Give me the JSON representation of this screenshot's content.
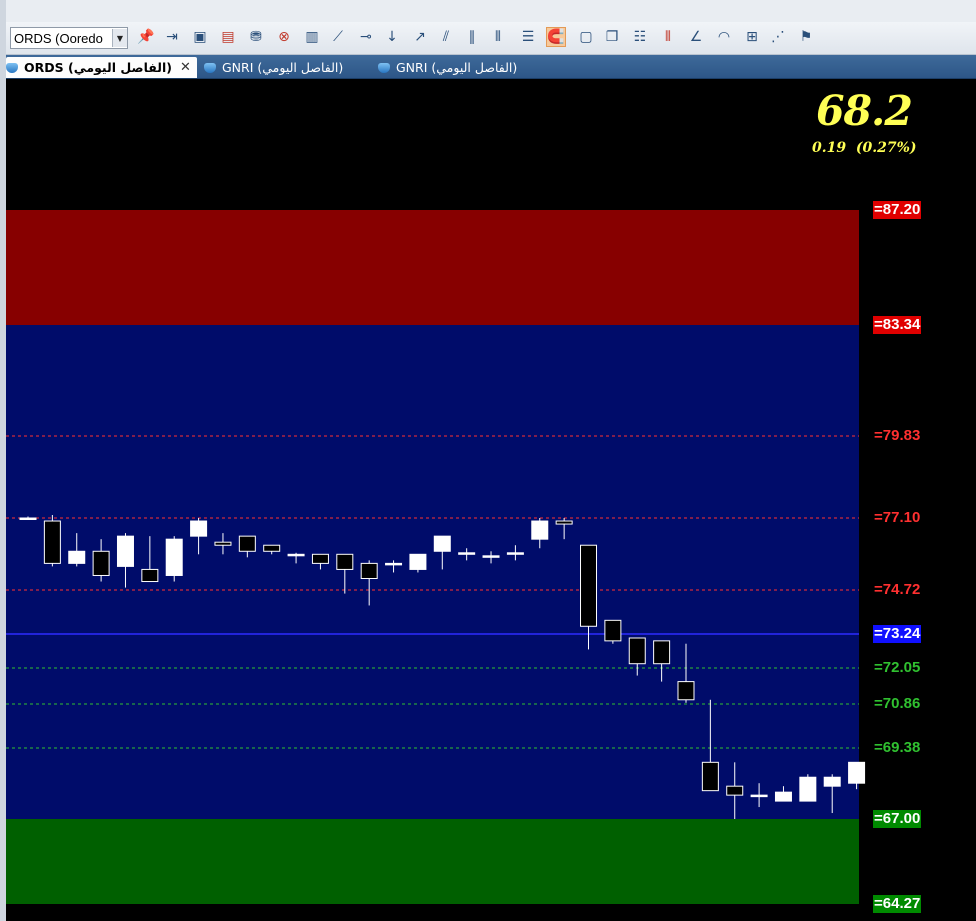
{
  "toolbar": {
    "symbol_select": {
      "value": "ORDS (Ooredo"
    },
    "icons": [
      {
        "name": "pin-icon",
        "glyph": "📌"
      },
      {
        "name": "import-icon",
        "glyph": "⇥"
      },
      {
        "name": "new-chart-icon",
        "glyph": "▣"
      },
      {
        "name": "delete-chart-icon",
        "glyph": "▤"
      },
      {
        "name": "network-icon",
        "glyph": "⛃"
      },
      {
        "name": "close-circle-icon",
        "glyph": "⊗"
      },
      {
        "name": "bar-chart-icon",
        "glyph": "▥"
      },
      {
        "name": "trend-line-icon",
        "glyph": "⟋"
      },
      {
        "name": "horizontal-line-icon",
        "glyph": "⊸"
      },
      {
        "name": "vertical-line-icon",
        "glyph": "↓"
      },
      {
        "name": "ray-icon",
        "glyph": "↗"
      },
      {
        "name": "parallel-lines-icon",
        "glyph": "⫽"
      },
      {
        "name": "double-slash-icon",
        "glyph": "∥"
      },
      {
        "name": "vertical-bars-icon",
        "glyph": "⦀"
      },
      {
        "name": "horizontal-levels-icon",
        "glyph": "☰"
      },
      {
        "name": "magnet-icon",
        "glyph": "🧲"
      },
      {
        "name": "square-icon",
        "glyph": "▢"
      },
      {
        "name": "copy-icon",
        "glyph": "❐"
      },
      {
        "name": "levels-icon",
        "glyph": "☷"
      },
      {
        "name": "vertical-lines-icon",
        "glyph": "⦀"
      },
      {
        "name": "angle-icon",
        "glyph": "∠"
      },
      {
        "name": "arc-icon",
        "glyph": "◠"
      },
      {
        "name": "grid-icon",
        "glyph": "⊞"
      },
      {
        "name": "fan-icon",
        "glyph": "⋰"
      },
      {
        "name": "flag-icon",
        "glyph": "⚑"
      }
    ]
  },
  "tabs": [
    {
      "label": "ORDS (الفاصل اليومي)",
      "active": true,
      "close": "✕"
    },
    {
      "label": "GNRI (الفاصل اليومي)",
      "active": false
    },
    {
      "label": "GNRI (الفاصل اليومي)",
      "active": false
    }
  ],
  "quote": {
    "price": "68.2",
    "change": "0.19  (0.27%)"
  },
  "colors": {
    "red_zone": "#870000",
    "blue_zone": "#000c6a",
    "green_zone": "#006000",
    "red_label_bg": "#e00000",
    "blue_label_bg": "#1010ff",
    "green_label_bg": "#008a00",
    "red_line": "#ff3030",
    "green_line": "#30c030",
    "blue_line": "#2d2dff",
    "price_text": "#ffff55"
  },
  "chart_data": {
    "type": "candlestick",
    "levels": [
      {
        "value": 87.2,
        "label": "=87.20",
        "style": "badge",
        "color": "red"
      },
      {
        "value": 83.34,
        "label": "=83.34",
        "style": "badge",
        "color": "red"
      },
      {
        "value": 79.83,
        "label": "=79.83",
        "style": "dashed",
        "color": "red"
      },
      {
        "value": 77.1,
        "label": "=77.10",
        "style": "dashed",
        "color": "red"
      },
      {
        "value": 74.72,
        "label": "=74.72",
        "style": "dashed",
        "color": "red"
      },
      {
        "value": 73.24,
        "label": "=73.24",
        "style": "badge",
        "color": "blue"
      },
      {
        "value": 72.05,
        "label": "=72.05",
        "style": "dashed",
        "color": "green"
      },
      {
        "value": 70.86,
        "label": "=70.86",
        "style": "dashed",
        "color": "green"
      },
      {
        "value": 69.38,
        "label": "=69.38",
        "style": "dashed",
        "color": "green"
      },
      {
        "value": 67.0,
        "label": "=67.00",
        "style": "badge",
        "color": "green"
      },
      {
        "value": 64.27,
        "label": "=64.27",
        "style": "badge",
        "color": "green"
      }
    ],
    "zones": [
      {
        "from": 87.2,
        "to": 83.34,
        "color": "red"
      },
      {
        "from": 83.34,
        "to": 67.0,
        "color": "blue"
      },
      {
        "from": 67.0,
        "to": 64.27,
        "color": "green"
      }
    ],
    "candles": [
      {
        "o": 77.1,
        "h": 77.15,
        "l": 77.05,
        "c": 77.1
      },
      {
        "o": 77.0,
        "h": 77.2,
        "l": 75.5,
        "c": 75.6
      },
      {
        "o": 75.6,
        "h": 76.6,
        "l": 75.5,
        "c": 76.0
      },
      {
        "o": 76.0,
        "h": 76.4,
        "l": 75.0,
        "c": 75.2
      },
      {
        "o": 75.5,
        "h": 76.6,
        "l": 74.8,
        "c": 76.5
      },
      {
        "o": 75.4,
        "h": 76.5,
        "l": 75.0,
        "c": 75.0
      },
      {
        "o": 75.2,
        "h": 76.5,
        "l": 75.0,
        "c": 76.4
      },
      {
        "o": 76.5,
        "h": 77.1,
        "l": 75.9,
        "c": 77.0
      },
      {
        "o": 76.3,
        "h": 76.6,
        "l": 75.9,
        "c": 76.2
      },
      {
        "o": 76.5,
        "h": 76.5,
        "l": 75.8,
        "c": 76.0
      },
      {
        "o": 76.2,
        "h": 76.2,
        "l": 75.9,
        "c": 76.0
      },
      {
        "o": 75.9,
        "h": 75.95,
        "l": 75.6,
        "c": 75.9
      },
      {
        "o": 75.9,
        "h": 75.9,
        "l": 75.4,
        "c": 75.6
      },
      {
        "o": 75.9,
        "h": 75.9,
        "l": 74.6,
        "c": 75.4
      },
      {
        "o": 75.6,
        "h": 75.7,
        "l": 74.2,
        "c": 75.1
      },
      {
        "o": 75.6,
        "h": 75.7,
        "l": 75.3,
        "c": 75.6
      },
      {
        "o": 75.4,
        "h": 75.9,
        "l": 75.3,
        "c": 75.9
      },
      {
        "o": 76.0,
        "h": 76.4,
        "l": 75.4,
        "c": 76.5
      },
      {
        "o": 75.9,
        "h": 76.1,
        "l": 75.7,
        "c": 75.95
      },
      {
        "o": 75.85,
        "h": 76.0,
        "l": 75.6,
        "c": 75.85
      },
      {
        "o": 75.9,
        "h": 76.2,
        "l": 75.7,
        "c": 75.95
      },
      {
        "o": 76.4,
        "h": 77.1,
        "l": 76.1,
        "c": 77.0
      },
      {
        "o": 77.0,
        "h": 77.1,
        "l": 76.4,
        "c": 76.9
      },
      {
        "o": 76.2,
        "h": 76.2,
        "l": 72.7,
        "c": 73.5
      },
      {
        "o": 73.7,
        "h": 73.7,
        "l": 72.9,
        "c": 73.0
      },
      {
        "o": 73.1,
        "h": 73.1,
        "l": 71.8,
        "c": 72.2
      },
      {
        "o": 73.0,
        "h": 73.0,
        "l": 71.6,
        "c": 72.2
      },
      {
        "o": 71.6,
        "h": 72.9,
        "l": 70.9,
        "c": 71.0
      },
      {
        "o": 68.9,
        "h": 71.0,
        "l": 67.95,
        "c": 67.95
      },
      {
        "o": 68.1,
        "h": 68.9,
        "l": 67.0,
        "c": 67.8
      },
      {
        "o": 67.8,
        "h": 68.2,
        "l": 67.4,
        "c": 67.8
      },
      {
        "o": 67.6,
        "h": 68.1,
        "l": 67.6,
        "c": 67.9
      },
      {
        "o": 67.6,
        "h": 68.5,
        "l": 67.6,
        "c": 68.4
      },
      {
        "o": 68.1,
        "h": 68.5,
        "l": 67.2,
        "c": 68.4
      },
      {
        "o": 68.2,
        "h": 68.9,
        "l": 68.0,
        "c": 68.9
      }
    ]
  }
}
